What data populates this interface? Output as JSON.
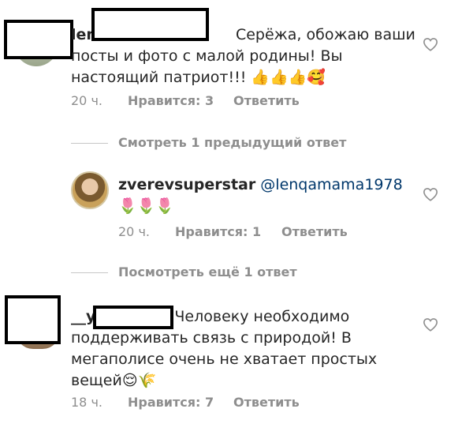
{
  "comments": [
    {
      "username_visible": "len",
      "text_lines": [
        "Серёжа, обожаю ваши",
        "посты и фото с малой родины! Вы",
        "настоящий патриот!!!"
      ],
      "emojis": [
        "👍",
        "👍",
        "👍",
        "🥰"
      ],
      "time": "20 ч.",
      "likes": "Нравится: 3",
      "reply": "Ответить",
      "like_icon": "heart-outline-icon"
    },
    {
      "username": "zverevsuperstar",
      "mention": "@lenqamama1978",
      "emojis": [
        "🌷",
        "🌷",
        "🌷"
      ],
      "time": "20 ч.",
      "likes": "Нравится: 1",
      "reply": "Ответить",
      "like_icon": "heart-outline-icon"
    },
    {
      "username_visible": "__у",
      "text_lines": [
        "Человеку необходимо",
        "поддерживать связь с природой! В",
        "мегаполисе очень не хватает простых",
        "вещей"
      ],
      "emojis": [
        "😌",
        "🌾"
      ],
      "time": "18 ч.",
      "likes": "Нравится: 7",
      "reply": "Ответить",
      "like_icon": "heart-outline-icon"
    }
  ],
  "view_replies_1": "Смотреть 1 предыдущий ответ",
  "view_replies_2": "Посмотреть ещё 1 ответ",
  "colors": {
    "text": "#262626",
    "secondary": "#8e8e8e",
    "mention": "#00376b",
    "divider": "#c7c7c7",
    "redaction_border": "#000000"
  }
}
